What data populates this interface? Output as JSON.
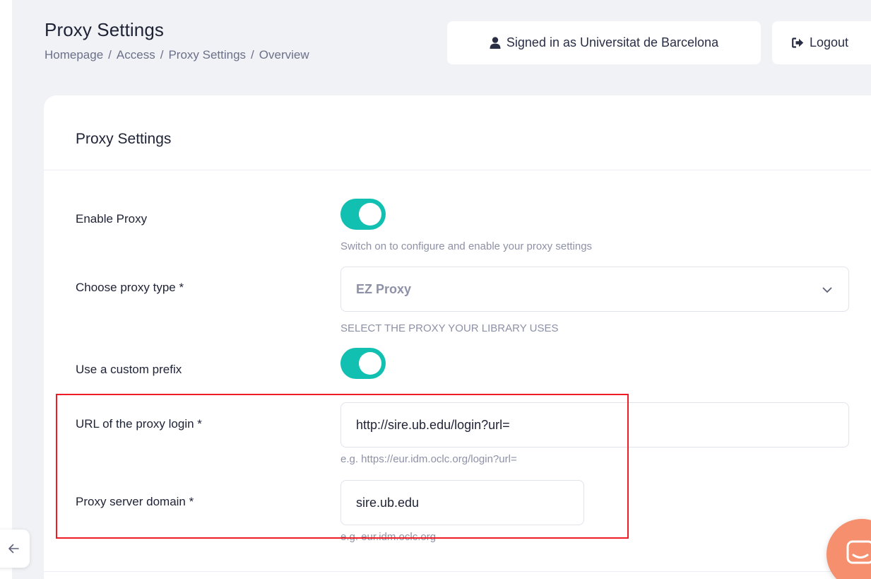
{
  "header": {
    "page_title": "Proxy Settings",
    "breadcrumb": [
      "Homepage",
      "Access",
      "Proxy Settings",
      "Overview"
    ],
    "breadcrumb_separator": "/",
    "signed_in_label": "Signed in as Universitat de Barcelona",
    "logout_label": "Logout"
  },
  "card": {
    "title": "Proxy Settings",
    "enable_proxy": {
      "label": "Enable Proxy",
      "state": "on",
      "help": "Switch on to configure and enable your proxy settings"
    },
    "proxy_type": {
      "label": "Choose proxy type *",
      "value": "EZ Proxy",
      "help": "SELECT THE PROXY YOUR LIBRARY USES"
    },
    "custom_prefix": {
      "label": "Use a custom prefix",
      "state": "on"
    },
    "proxy_login_url": {
      "label": "URL of the proxy login *",
      "value": "http://sire.ub.edu/login?url=",
      "help": "e.g. https://eur.idm.oclc.org/login?url="
    },
    "proxy_domain": {
      "label": "Proxy server domain *",
      "value": "sire.ub.edu",
      "help": "e.g. eur.idm.oclc.org"
    }
  },
  "icons": {
    "user": "user-icon",
    "logout": "logout-icon",
    "chevron": "chevron-down-icon",
    "back": "arrow-left-icon",
    "chat": "chat-icon"
  },
  "colors": {
    "accent_toggle": "#12c0b2",
    "highlight": "#ee1c25",
    "chat_button": "#f58f6e",
    "page_background": "#f1f2f6"
  }
}
